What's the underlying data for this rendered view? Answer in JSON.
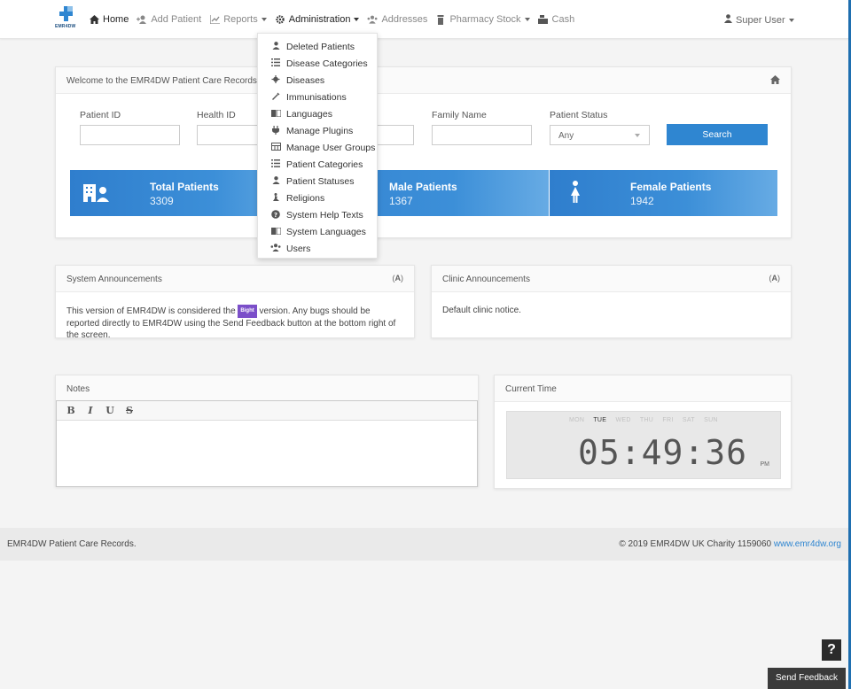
{
  "app": {
    "logo_text": "EMR4DW"
  },
  "nav": {
    "home": "Home",
    "add_patient": "Add Patient",
    "reports": "Reports",
    "administration": "Administration",
    "addresses": "Addresses",
    "pharmacy_stock": "Pharmacy Stock",
    "cash": "Cash",
    "user": "Super User"
  },
  "admin_menu": {
    "items": [
      {
        "label": "Deleted Patients",
        "icon": "user-icon"
      },
      {
        "label": "Disease Categories",
        "icon": "list-icon"
      },
      {
        "label": "Diseases",
        "icon": "virus-icon"
      },
      {
        "label": "Immunisations",
        "icon": "syringe-icon"
      },
      {
        "label": "Languages",
        "icon": "language-icon"
      },
      {
        "label": "Manage Plugins",
        "icon": "plug-icon"
      },
      {
        "label": "Manage User Groups",
        "icon": "table-icon"
      },
      {
        "label": "Patient Categories",
        "icon": "list-icon"
      },
      {
        "label": "Patient Statuses",
        "icon": "user-icon"
      },
      {
        "label": "Religions",
        "icon": "pray-icon"
      },
      {
        "label": "System Help Texts",
        "icon": "question-circle-icon"
      },
      {
        "label": "System Languages",
        "icon": "language-icon"
      },
      {
        "label": "Users",
        "icon": "users-icon"
      }
    ]
  },
  "welcome": {
    "title": "Welcome to the EMR4DW Patient Care Records syst",
    "fields": {
      "patient_id": "Patient ID",
      "health_id": "Health ID",
      "family_name": "Family Name",
      "patient_status": "Patient Status",
      "status_value": "Any"
    },
    "search_label": "Search",
    "stats": {
      "total_label": "Total Patients",
      "total_value": "3309",
      "male_label": "Male Patients",
      "male_value": "1367",
      "female_label": "Female Patients",
      "female_value": "1942"
    }
  },
  "system_announcements": {
    "title": "System Announcements",
    "text_before": "This version of EMR4DW is considered the",
    "badge": "Bight",
    "text_after": "version. Any bugs should be reported directly to EMR4DW using the Send Feedback button at the bottom right of the screen."
  },
  "clinic_announcements": {
    "title": "Clinic Announcements",
    "text": "Default clinic notice."
  },
  "notes": {
    "title": "Notes",
    "toolbar": {
      "bold": "B",
      "italic": "I",
      "underline": "U",
      "strike": "S"
    }
  },
  "clock": {
    "title": "Current Time",
    "days": [
      "MON",
      "TUE",
      "WED",
      "THU",
      "FRI",
      "SAT",
      "SUN"
    ],
    "current_day": "TUE",
    "time": "05:49:36",
    "ampm": "PM"
  },
  "footer": {
    "left": "EMR4DW Patient Care Records.",
    "right_text": "© 2019 EMR4DW  UK Charity 1159060",
    "right_link": "www.emr4dw.org"
  },
  "help_label": "?",
  "feedback_label": "Send Feedback",
  "colors": {
    "primary": "#2f86d1",
    "badge": "#7b4fc9"
  }
}
